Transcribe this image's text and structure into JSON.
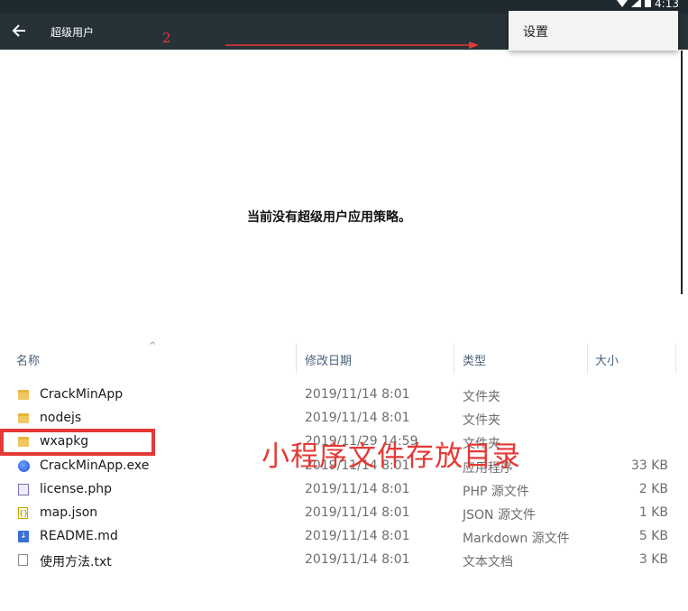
{
  "status_bar": {
    "time": "4:13",
    "icons": [
      "wifi-icon",
      "signal-icon",
      "battery-icon"
    ]
  },
  "android": {
    "toolbar_title": "超级用户",
    "menu_item_settings": "设置",
    "empty_message": "当前没有超级用户应用策略。",
    "annotation_number": "2",
    "colors": {
      "toolbar": "#263238",
      "annotation": "#e53935"
    }
  },
  "explorer": {
    "columns": {
      "name": "名称",
      "date": "修改日期",
      "type": "类型",
      "size": "大小"
    },
    "files": [
      {
        "icon": "folder-icon",
        "name": "CrackMinApp",
        "date": "2019/11/14 8:01",
        "type": "文件夹",
        "size": ""
      },
      {
        "icon": "folder-icon",
        "name": "nodejs",
        "date": "2019/11/14 8:01",
        "type": "文件夹",
        "size": ""
      },
      {
        "icon": "folder-icon",
        "name": "wxapkg",
        "date": "2019/11/29 14:59",
        "type": "文件夹",
        "size": ""
      },
      {
        "icon": "exe-icon",
        "name": "CrackMinApp.exe",
        "date": "2019/11/14 8:01",
        "type": "应用程序",
        "size": "33 KB"
      },
      {
        "icon": "php-file-icon",
        "name": "license.php",
        "date": "2019/11/14 8:01",
        "type": "PHP 源文件",
        "size": "2 KB"
      },
      {
        "icon": "json-file-icon",
        "name": "map.json",
        "date": "2019/11/14 8:01",
        "type": "JSON 源文件",
        "size": "1 KB"
      },
      {
        "icon": "markdown-file-icon",
        "name": "README.md",
        "date": "2019/11/14 8:01",
        "type": "Markdown 源文件",
        "size": "5 KB"
      },
      {
        "icon": "text-file-icon",
        "name": "使用方法.txt",
        "date": "2019/11/14 8:01",
        "type": "文本文档",
        "size": "3 KB"
      }
    ],
    "annotation_caption": "小程序文件存放目录"
  }
}
